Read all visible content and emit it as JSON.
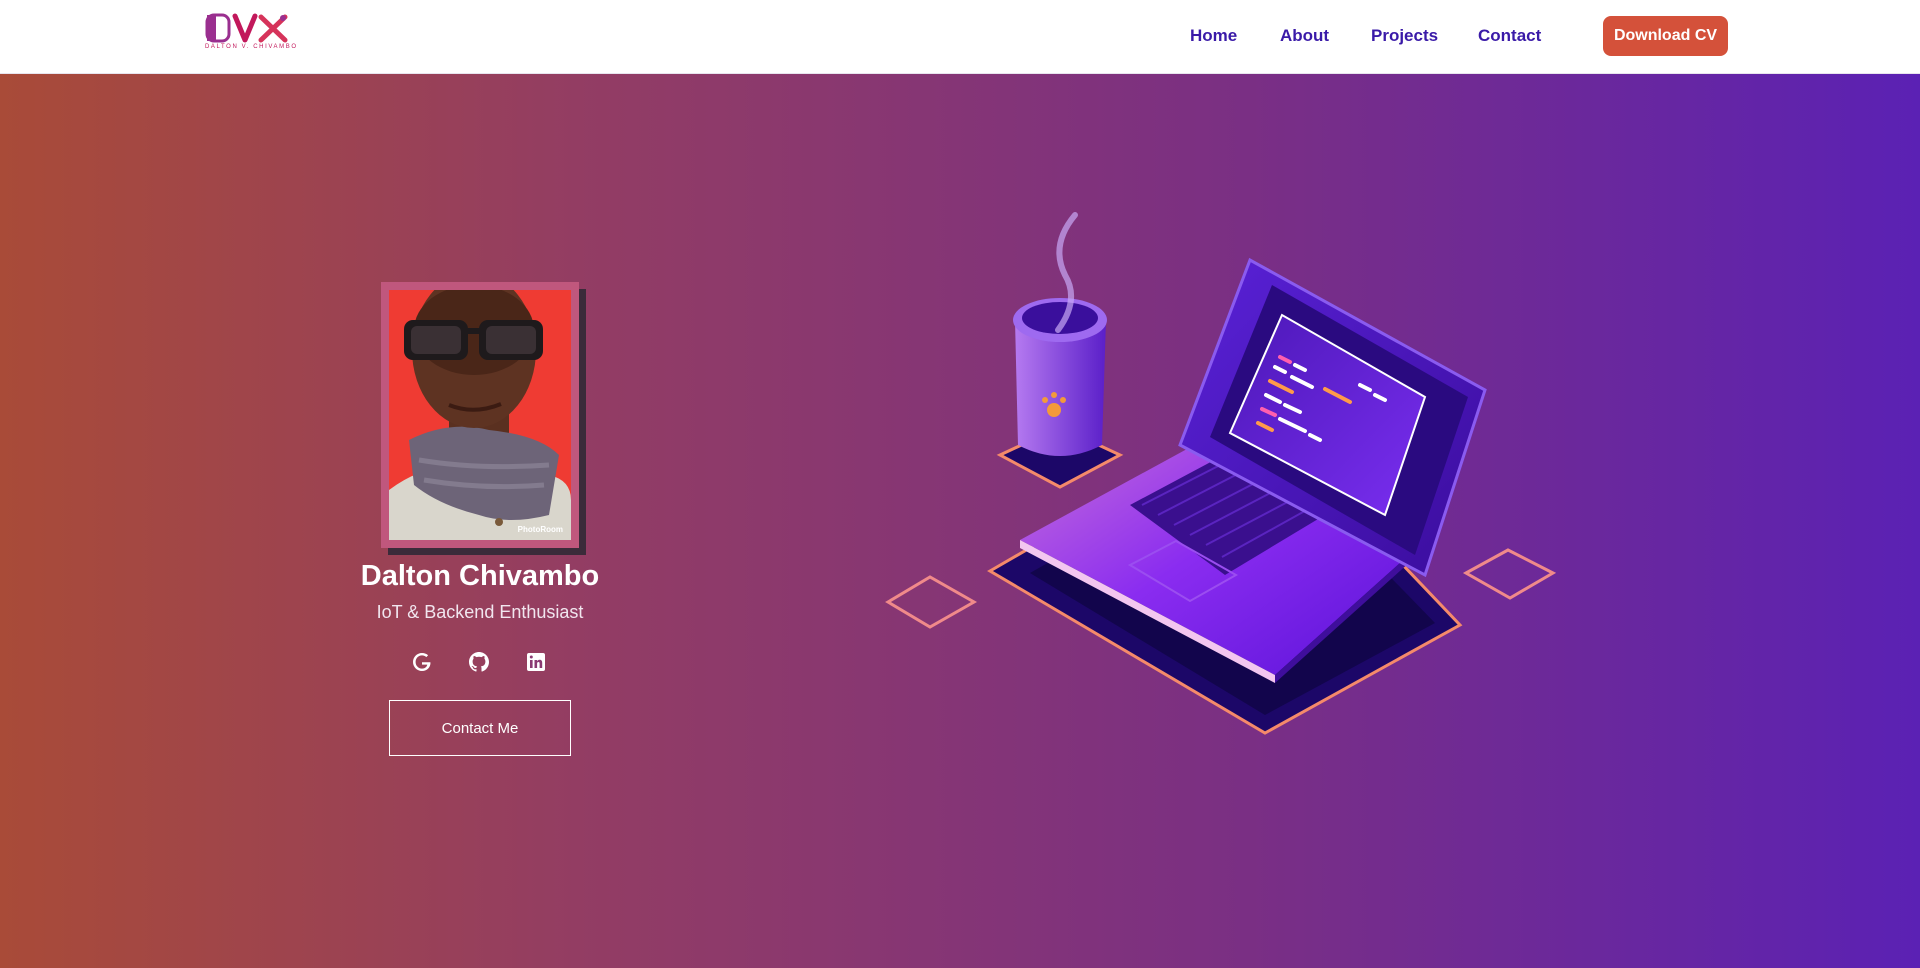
{
  "header": {
    "logo": {
      "mark": "DVX",
      "subtitle": "DALTON V. CHIVAMBO"
    },
    "nav": [
      {
        "label": "Home"
      },
      {
        "label": "About"
      },
      {
        "label": "Projects"
      },
      {
        "label": "Contact"
      }
    ],
    "cv_button": "Download CV"
  },
  "hero": {
    "name": "Dalton Chivambo",
    "role": "IoT & Backend Enthusiast",
    "photo_watermark": "PhotoRoom",
    "socials": [
      {
        "icon": "google-icon"
      },
      {
        "icon": "github-icon"
      },
      {
        "icon": "linkedin-icon"
      }
    ],
    "contact_button": "Contact Me",
    "illustration": "laptop-with-coffee-cup"
  },
  "colors": {
    "nav_text": "#3a1aa8",
    "cv_button": "#d4513a",
    "gradient_start": "#a94b38",
    "gradient_end": "#5b21b4",
    "logo_pink": "#c2185b"
  }
}
